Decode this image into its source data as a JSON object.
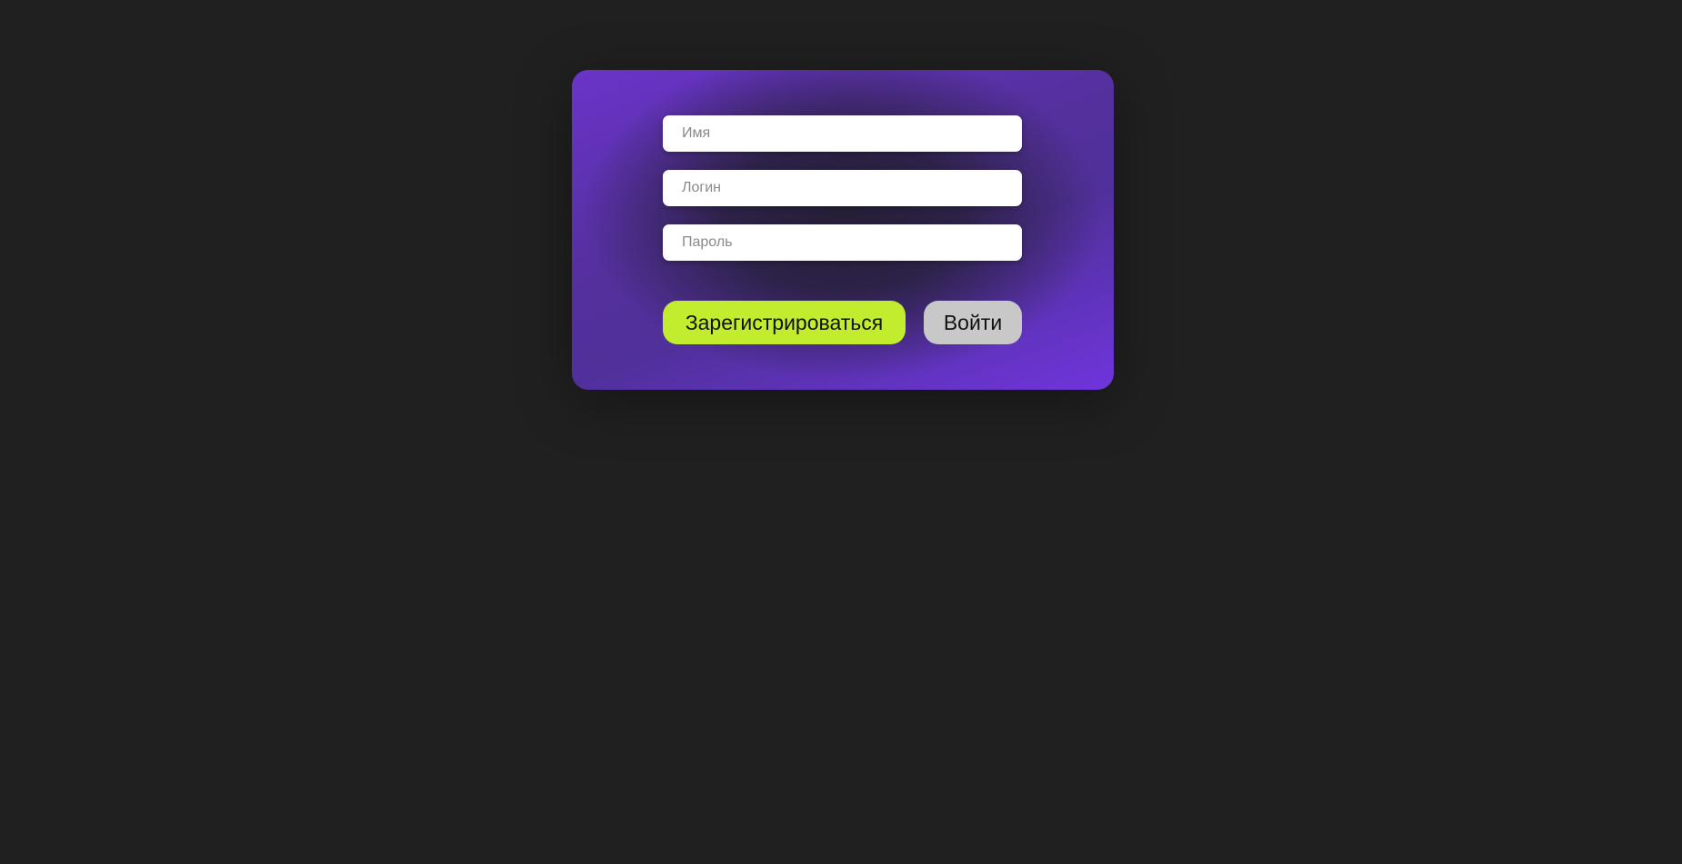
{
  "form": {
    "name_placeholder": "Имя",
    "login_placeholder": "Логин",
    "password_placeholder": "Пароль",
    "name_value": "",
    "login_value": "",
    "password_value": ""
  },
  "buttons": {
    "register_label": "Зарегистрироваться",
    "login_label": "Войти"
  },
  "colors": {
    "page_background": "#202020",
    "card_accent": "#6a34c9",
    "register_button": "#c2ed2e",
    "login_button": "#c8c8c8"
  }
}
